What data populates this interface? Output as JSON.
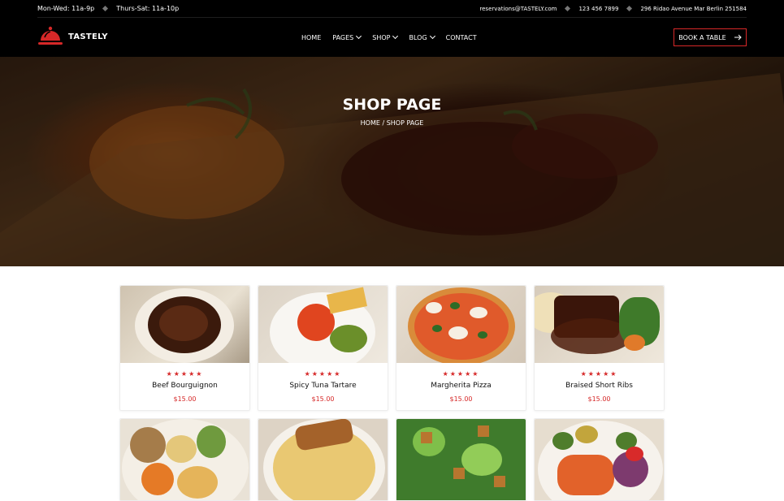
{
  "topbar": {
    "hours_1": "Mon-Wed: 11a-9p",
    "hours_2": "Thurs-Sat: 11a-10p",
    "email": "reservations@TASTELY.com",
    "phone": "123 456 7899",
    "address": "296 Ridao Avenue Mar Berlin 251584"
  },
  "nav": {
    "logo": "TASTELY",
    "items": [
      {
        "label": "HOME"
      },
      {
        "label": "PAGES"
      },
      {
        "label": "SHOP"
      },
      {
        "label": "BLOG"
      },
      {
        "label": "CONTACT"
      }
    ],
    "cta": "BOOK A TABLE"
  },
  "hero": {
    "title": "SHOP PAGE",
    "breadcrumb": "HOME / SHOP PAGE"
  },
  "rating_stars": "★★★★★",
  "products": [
    {
      "name": "Beef Bourguignon",
      "price": "$15.00"
    },
    {
      "name": "Spicy Tuna Tartare",
      "price": "$15.00"
    },
    {
      "name": "Margherita Pizza",
      "price": "$15.00"
    },
    {
      "name": "Braised Short Ribs",
      "price": "$15.00"
    }
  ],
  "colors": {
    "accent": "#d62828",
    "dark": "#000000"
  }
}
